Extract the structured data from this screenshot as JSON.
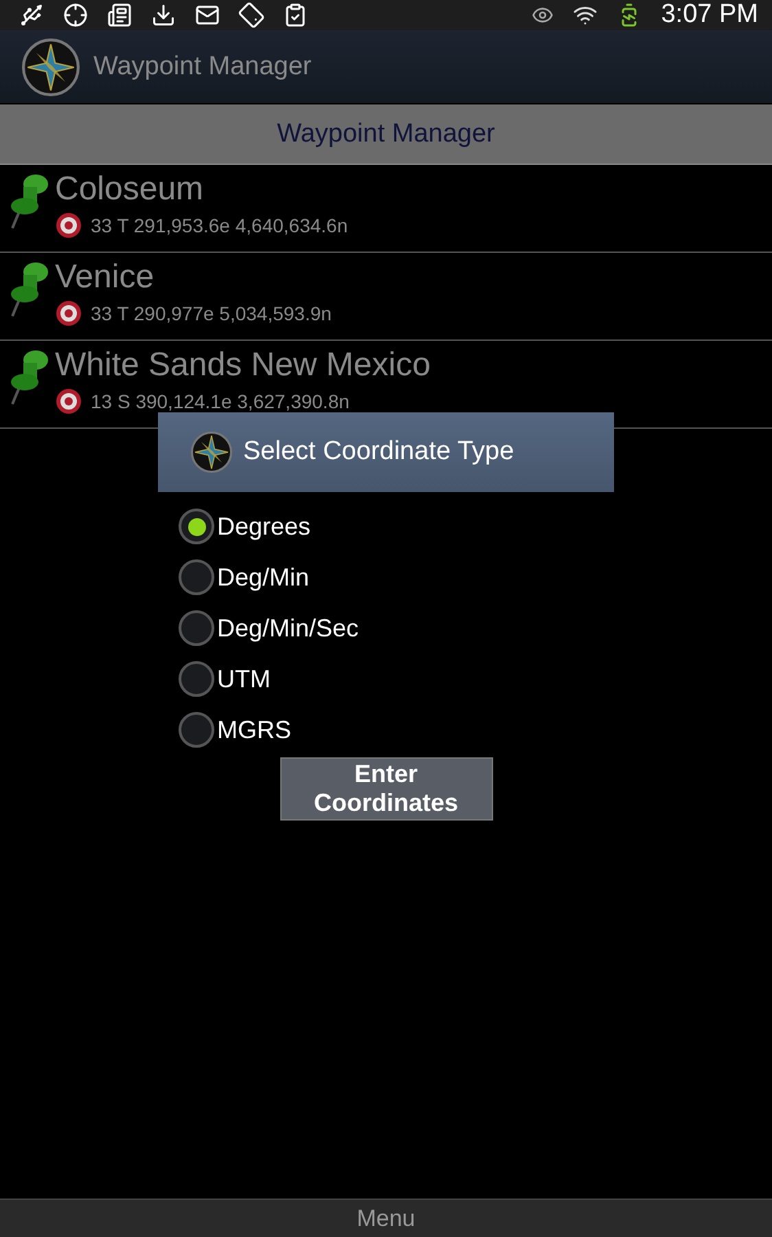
{
  "status_bar": {
    "time": "3:07 PM"
  },
  "action_bar": {
    "title": "Waypoint Manager"
  },
  "header": {
    "title": "Waypoint Manager"
  },
  "waypoints": [
    {
      "name": "Coloseum",
      "coordinates": "33 T 291,953.6e 4,640,634.6n"
    },
    {
      "name": "Venice",
      "coordinates": "33 T 290,977e 5,034,593.9n"
    },
    {
      "name": "White Sands New Mexico",
      "coordinates": "13 S 390,124.1e 3,627,390.8n"
    }
  ],
  "dialog": {
    "title": "Select Coordinate Type",
    "options": [
      {
        "label": "Degrees",
        "selected": true
      },
      {
        "label": "Deg/Min",
        "selected": false
      },
      {
        "label": "Deg/Min/Sec",
        "selected": false
      },
      {
        "label": "UTM",
        "selected": false
      },
      {
        "label": "MGRS",
        "selected": false
      }
    ],
    "button": "Enter Coordinates"
  },
  "menu": {
    "label": "Menu"
  }
}
